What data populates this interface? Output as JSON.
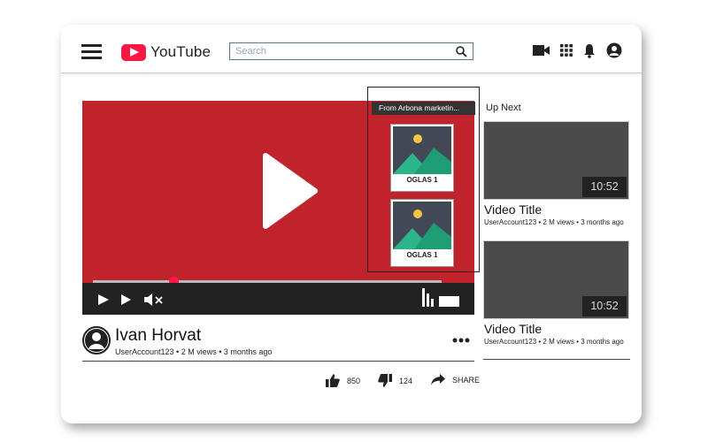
{
  "header": {
    "logo_text": "YouTube",
    "search_placeholder": "Search",
    "icons": [
      "menu-icon",
      "search-icon",
      "video-camera-icon",
      "apps-grid-icon",
      "bell-icon",
      "account-icon"
    ]
  },
  "player": {
    "progress_fraction": 0.23,
    "colors": {
      "background": "#c0232c",
      "knob": "#ff1744",
      "controls": "#222222"
    },
    "controls": [
      "play-icon",
      "next-icon",
      "mute-icon",
      "bars-icon",
      "fullscreen-icon"
    ]
  },
  "ad": {
    "label": "From Arbona marketin...",
    "cards": [
      {
        "caption": "OGLAS 1"
      },
      {
        "caption": "OGLAS 1"
      }
    ]
  },
  "up_next": {
    "heading": "Up Next",
    "videos": [
      {
        "duration": "10:52",
        "title": "Video Title",
        "meta": "UserAccount123 • 2 M views • 3 months ago"
      },
      {
        "duration": "10:52",
        "title": "Video Title",
        "meta": "UserAccount123 • 2 M views • 3 months ago"
      }
    ]
  },
  "video_info": {
    "channel_name": "Ivan Horvat",
    "meta": "UserAccount123 • 2 M views • 3 months ago",
    "likes": "850",
    "dislikes": "124",
    "share_label": "SHARE"
  }
}
